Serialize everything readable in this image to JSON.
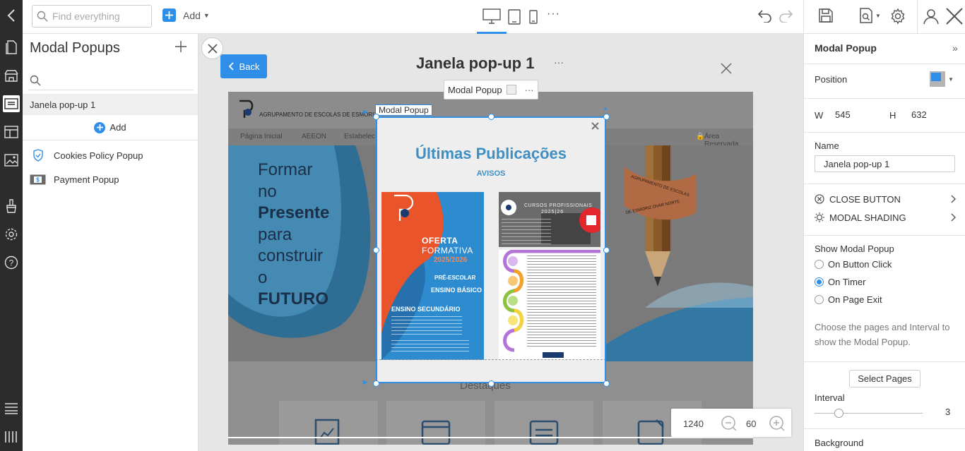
{
  "search": {
    "placeholder": "Find everything"
  },
  "toolbar": {
    "add_label": "Add",
    "more_label": "···"
  },
  "left_panel": {
    "title": "Modal Popups",
    "items": [
      {
        "label": "Janela pop-up 1"
      },
      {
        "label": "Cookies Policy Popup"
      },
      {
        "label": "Payment Popup"
      }
    ],
    "add_label": "Add"
  },
  "canvas": {
    "back_label": "Back",
    "popup_title": "Janela pop-up 1",
    "more_label": "···",
    "chip_label": "Modal Popup",
    "selection_label": "Modal Popup",
    "zoom_width": "1240",
    "zoom_value": "60",
    "site": {
      "school_name": "AGRUPAMENTO DE ESCOLAS DE ESMORIZ",
      "nav": [
        "Página Inicial",
        "AEEON",
        "Estabelec"
      ],
      "reserved": "Área Reservada",
      "hero_lines": [
        "Formar",
        "no",
        "Presente",
        "para",
        "construir",
        "o",
        "FUTURO"
      ],
      "ribbon_top": "AGRUPAMENTO DE ESCOLAS",
      "ribbon_bottom": "DE ESMORIZ OVAR NORTE",
      "destaques": "Destaques"
    },
    "popup": {
      "heading": "Últimas Publicações",
      "subheading": "AVISOS",
      "poster1": {
        "line1": "OFERTA",
        "line2": "FORMATIVA",
        "year": "2025/2026",
        "l3": "PRÉ-ESCOLAR",
        "l4": "ENSINO BÁSICO",
        "l5": "ENSINO SECUNDÁRIO"
      },
      "poster2": {
        "title": "CURSOS PROFISSIONAIS",
        "years": "2025|26"
      }
    }
  },
  "right_panel": {
    "title": "Modal Popup",
    "position_label": "Position",
    "w_label": "W",
    "w_value": "545",
    "h_label": "H",
    "h_value": "632",
    "name_label": "Name",
    "name_value": "Janela pop-up 1",
    "close_button_label": "CLOSE BUTTON",
    "modal_shading_label": "MODAL SHADING",
    "show_label": "Show Modal Popup",
    "options": [
      "On Button Click",
      "On Timer",
      "On Page Exit"
    ],
    "selected_option": "On Timer",
    "hint": "Choose the pages and Interval to show the Modal Popup.",
    "select_pages_label": "Select Pages",
    "interval_label": "Interval",
    "interval_value": "3",
    "background_label": "Background"
  },
  "colors": {
    "accent": "#2e8ee8",
    "rail": "#2c2c2c",
    "popup_heading": "#3d8fc4"
  }
}
